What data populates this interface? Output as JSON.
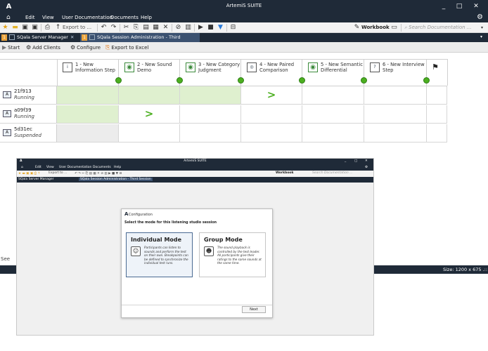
{
  "window": {
    "title": "ArtemiS SUITE",
    "minimize": "_",
    "maximize": "□",
    "close": "✕"
  },
  "menu": {
    "items": [
      "Edit",
      "View",
      "User Documentation",
      "Documents",
      "Help"
    ]
  },
  "toolbar": {
    "export_label": "Export to ...",
    "workbook_label": "Workbook",
    "search_placeholder": "Search Documentation ..."
  },
  "tabs": [
    {
      "badge": "1",
      "label": "SQala Server Manager",
      "active": false
    },
    {
      "badge": "1",
      "label": "SQala Session Administration - Third Session",
      "active": true
    }
  ],
  "actions": {
    "start": "Start",
    "add_clients": "Add Clients",
    "configure": "Configure",
    "export_excel": "Export to Excel"
  },
  "steps": [
    {
      "label": "1 - New Information Step",
      "icon": "info-step-icon"
    },
    {
      "label": "2 - New Sound Demo",
      "icon": "demo-icon"
    },
    {
      "label": "3 - New Category Judgment",
      "icon": "category-icon"
    },
    {
      "label": "4 - New Paired Comparison",
      "icon": "paired-icon"
    },
    {
      "label": "5 - New Semantic Differential",
      "icon": "semantic-icon"
    },
    {
      "label": "6 - New Interview Step",
      "icon": "interview-icon"
    }
  ],
  "clients": [
    {
      "name": "21f913",
      "state": "Running"
    },
    {
      "name": "a09f39",
      "state": "Running"
    },
    {
      "name": "5d31ec",
      "state": "Suspended"
    }
  ],
  "status": {
    "left_text": "See",
    "size": "Size: 1200 x 675 .::"
  },
  "inner": {
    "title": "ArtemiS SUITE",
    "menu_items": [
      "Edit",
      "View",
      "User Documentation",
      "Documents",
      "Help"
    ],
    "export_label": "Export to ...",
    "workbook_label": "Workbook",
    "search_placeholder": "Search Documentation ...",
    "tab1": "SQala Server Manager",
    "tab2": "SQala Session Administration - Third Session"
  },
  "dialog": {
    "title": "Configuration",
    "prompt": "Select the mode for this listening studio session",
    "individual": {
      "name": "Individual Mode",
      "desc": "Participants can listen to sounds and perform the test on their own. Breakpoints can be defined to synchronize the individual test runs."
    },
    "group": {
      "name": "Group Mode",
      "desc": "The sound playback is controlled by the test leader. All participants give their ratings to the same sounds at the same time."
    },
    "next_label": "Next"
  },
  "colors": {
    "chrome": "#1f2a38",
    "done_cell": "#dff0cf",
    "progress_green": "#4caf20",
    "tab_badge": "#e9a23b"
  }
}
